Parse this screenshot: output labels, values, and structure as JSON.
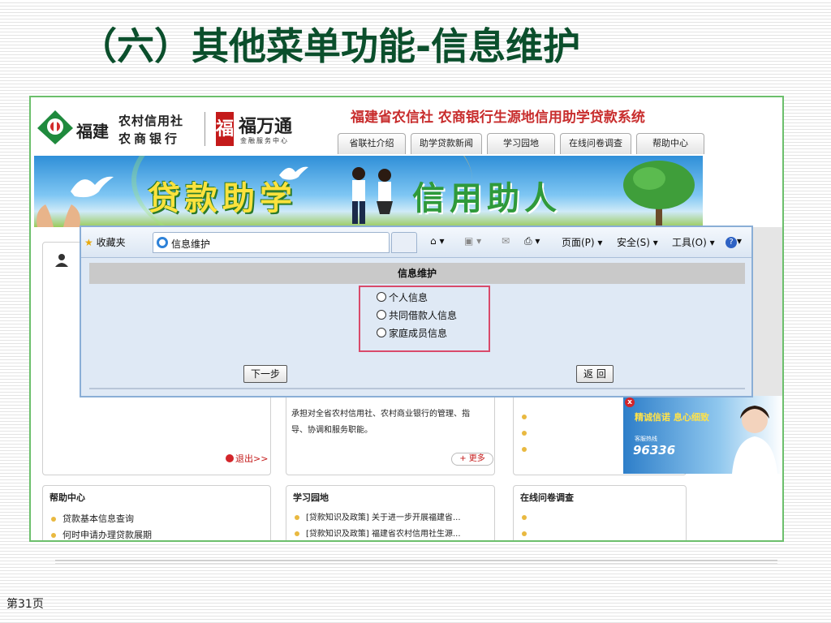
{
  "slide": {
    "title": "（六）其他菜单功能-信息维护",
    "page_number": "第31页"
  },
  "site": {
    "brand_region": "福建",
    "brand_bank_line1": "农村信用社",
    "brand_bank_line2": "农商银行",
    "brand2_name": "福万通",
    "brand2_sub": "金融服务中心",
    "system_title": "福建省农信社 农商银行生源地信用助学贷款系统",
    "nav": [
      "省联社介绍",
      "助学贷款新闻",
      "学习园地",
      "在线问卷调查",
      "帮助中心"
    ],
    "banner_left": "贷款助学",
    "banner_right": "信用助人"
  },
  "lower": {
    "logout": "退出>>",
    "news_text_line1": "承担对全省农村信用社、农村商业银行的管理、指",
    "news_text_line2": "导、协调和服务职能。",
    "more_button": "+ 更多",
    "help_title": "帮助中心",
    "help_items": [
      "贷款基本信息查询",
      "何时申请办理贷款展期"
    ],
    "study_title": "学习园地",
    "study_items": [
      "[贷款知识及政策] 关于进一步开展福建省...",
      "[贷款知识及政策] 福建省农村信用社生源..."
    ],
    "survey_title": "在线问卷调查",
    "hotline_slogan": "精诚信诺 息心细致",
    "hotline_label": "客服热线",
    "hotline_number": "96336"
  },
  "ie": {
    "favorites": "收藏夹",
    "tab_title": "信息维护",
    "page_menu": "页面(P)",
    "safety_menu": "安全(S)",
    "tools_menu": "工具(O)"
  },
  "form": {
    "header": "信息维护",
    "options": [
      "个人信息",
      "共同借款人信息",
      "家庭成员信息"
    ],
    "next_button": "下一步",
    "back_button": "返 回"
  },
  "colors": {
    "title_green": "#0b4f2c",
    "site_title_red": "#c82d2d",
    "highlight_box": "#d94a6a",
    "frame_green": "#6cbf6c"
  }
}
